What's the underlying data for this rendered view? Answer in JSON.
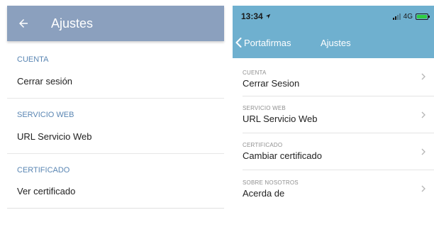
{
  "android": {
    "title": "Ajustes",
    "back_icon": "arrow-left-icon",
    "sections": [
      {
        "header": "CUENTA",
        "item": "Cerrar sesión"
      },
      {
        "header": "SERVICIO WEB",
        "item": "URL Servicio Web"
      },
      {
        "header": "CERTIFICADO",
        "item": "Ver certificado"
      }
    ]
  },
  "ios": {
    "status": {
      "time": "13:34",
      "network": "4G"
    },
    "back_label": "Portafirmas",
    "title": "Ajustes",
    "sections": [
      {
        "header": "CUENTA",
        "item": "Cerrar Sesion"
      },
      {
        "header": "SERVICIO WEB",
        "item": "URL Servicio Web"
      },
      {
        "header": "CERTIFICADO",
        "item": "Cambiar certificado"
      },
      {
        "header": "SOBRE NOSOTROS",
        "item": "Acerda de"
      }
    ]
  },
  "colors": {
    "android_appbar": "#8ba0be",
    "android_section": "#5a86b3",
    "ios_header": "#6fb0cf",
    "battery": "#2ecc40"
  }
}
